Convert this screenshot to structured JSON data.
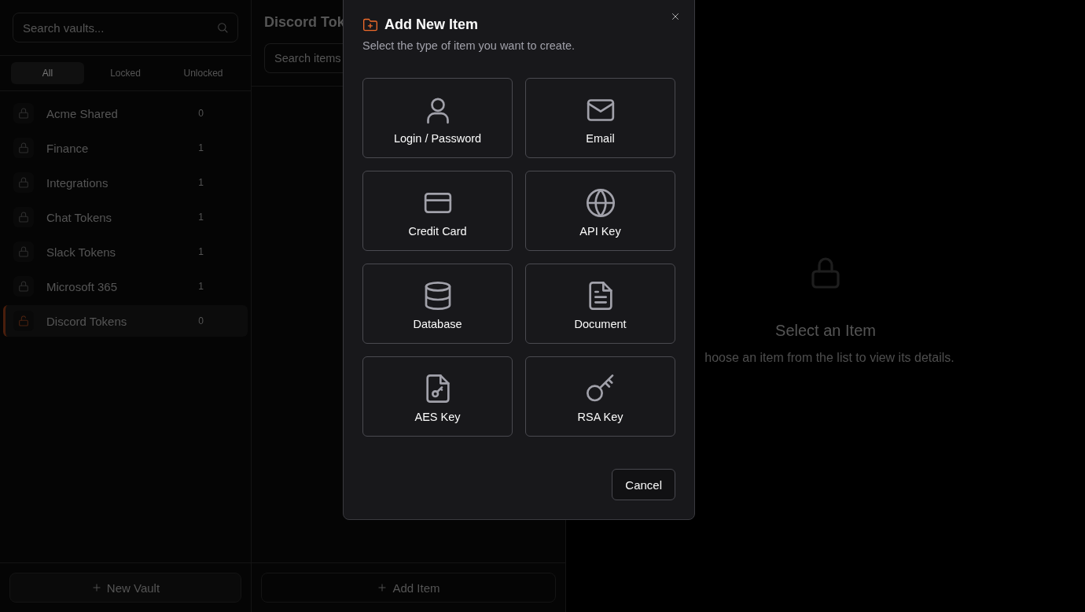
{
  "sidebar": {
    "search": {
      "placeholder": "Search vaults..."
    },
    "filters": [
      {
        "label": "All",
        "selected": true
      },
      {
        "label": "Locked",
        "selected": false
      },
      {
        "label": "Unlocked",
        "selected": false
      }
    ],
    "vaults": [
      {
        "name": "Acme Shared",
        "count": "0",
        "locked": true,
        "selected": false
      },
      {
        "name": "Finance",
        "count": "1",
        "locked": true,
        "selected": false
      },
      {
        "name": "Integrations",
        "count": "1",
        "locked": true,
        "selected": false
      },
      {
        "name": "Chat Tokens",
        "count": "1",
        "locked": true,
        "selected": false
      },
      {
        "name": "Slack Tokens",
        "count": "1",
        "locked": true,
        "selected": false
      },
      {
        "name": "Microsoft 365",
        "count": "1",
        "locked": true,
        "selected": false
      },
      {
        "name": "Discord Tokens",
        "count": "0",
        "locked": false,
        "selected": true
      }
    ],
    "new_vault_button": "New Vault"
  },
  "item_list": {
    "title": "Discord Tok",
    "search": {
      "placeholder": "Search items"
    },
    "add_item_button": "Add Item"
  },
  "detail": {
    "title": "Select an Item",
    "message": "hoose an item from the list to view its details."
  },
  "dialog": {
    "title": "Add New Item",
    "subtitle": "Select the type of item you want to create.",
    "options": [
      {
        "kind": "login",
        "label": "Login / Password"
      },
      {
        "kind": "email",
        "label": "Email"
      },
      {
        "kind": "card",
        "label": "Credit Card"
      },
      {
        "kind": "globe",
        "label": "API Key"
      },
      {
        "kind": "database",
        "label": "Database"
      },
      {
        "kind": "document",
        "label": "Document"
      },
      {
        "kind": "filekey",
        "label": "AES Key"
      },
      {
        "kind": "key",
        "label": "RSA Key"
      }
    ],
    "cancel_button": "Cancel"
  }
}
